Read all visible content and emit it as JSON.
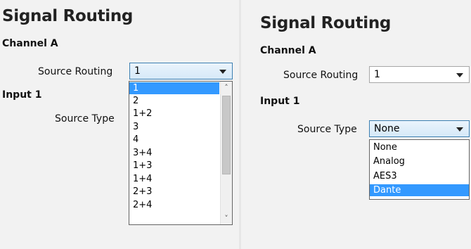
{
  "left": {
    "title": "Signal Routing",
    "channel_heading": "Channel A",
    "source_routing_label": "Source Routing",
    "source_routing_value": "1",
    "input_heading": "Input 1",
    "source_type_label": "Source Type",
    "routing_options": [
      {
        "label": "1",
        "selected": true
      },
      {
        "label": "2"
      },
      {
        "label": "1+2"
      },
      {
        "label": "3"
      },
      {
        "label": "4"
      },
      {
        "label": "3+4"
      },
      {
        "label": "1+3"
      },
      {
        "label": "1+4"
      },
      {
        "label": "2+3"
      },
      {
        "label": "2+4"
      }
    ],
    "scroll_up_icon": "chevron-up-icon",
    "scroll_down_icon": "chevron-down-icon"
  },
  "right": {
    "title": "Signal Routing",
    "channel_heading": "Channel A",
    "source_routing_label": "Source Routing",
    "source_routing_value": "1",
    "input_heading": "Input 1",
    "source_type_label": "Source Type",
    "source_type_value": "None",
    "type_options": [
      {
        "label": "None"
      },
      {
        "label": "Analog"
      },
      {
        "label": "AES3"
      },
      {
        "label": "Dante",
        "selected": true
      }
    ]
  },
  "colors": {
    "selection": "#3399ff",
    "background": "#f2f2f2"
  }
}
